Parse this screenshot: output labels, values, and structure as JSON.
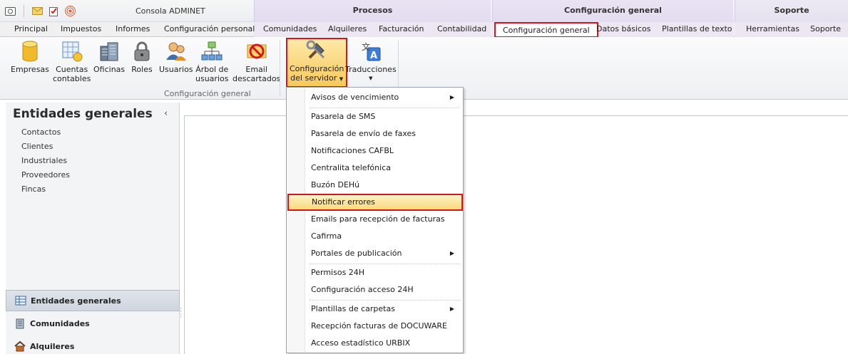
{
  "window": {
    "title": "Consola ADMINET"
  },
  "context_groups": [
    {
      "label": "Procesos"
    },
    {
      "label": "Configuración general"
    },
    {
      "label": "Soporte"
    }
  ],
  "tabs": [
    {
      "label": "Principal"
    },
    {
      "label": "Impuestos"
    },
    {
      "label": "Informes"
    },
    {
      "label": "Configuración personal"
    },
    {
      "label": "Comunidades"
    },
    {
      "label": "Alquileres"
    },
    {
      "label": "Facturación"
    },
    {
      "label": "Contabilidad"
    },
    {
      "label": "Configuración general",
      "active": true
    },
    {
      "label": "Datos básicos"
    },
    {
      "label": "Plantillas de texto"
    },
    {
      "label": "Herramientas"
    },
    {
      "label": "Soporte"
    }
  ],
  "ribbon": {
    "group_label": "Configuración general",
    "buttons": [
      {
        "line1": "Empresas",
        "line2": "",
        "icon": "database-icon"
      },
      {
        "line1": "Cuentas",
        "line2": "contables",
        "icon": "spreadsheet-icon"
      },
      {
        "line1": "Oficinas",
        "line2": "",
        "icon": "buildings-icon"
      },
      {
        "line1": "Roles",
        "line2": "",
        "icon": "padlock-icon"
      },
      {
        "line1": "Usuarios",
        "line2": "",
        "icon": "users-icon"
      },
      {
        "line1": "Árbol de",
        "line2": "usuarios",
        "icon": "org-tree-icon"
      },
      {
        "line1": "Email",
        "line2": "descartados",
        "icon": "blocked-email-icon"
      },
      {
        "line1": "Configuración",
        "line2": "del servidor",
        "icon": "tools-icon",
        "dropdown": true,
        "highlighted": true
      },
      {
        "line1": "Traducciones",
        "line2": "",
        "icon": "translate-icon",
        "dropdown": true
      }
    ]
  },
  "left_pane": {
    "title": "Entidades generales",
    "items": [
      "Contactos",
      "Clientes",
      "Industriales",
      "Proveedores",
      "Fincas"
    ],
    "nav": [
      {
        "label": "Entidades generales",
        "selected": true
      },
      {
        "label": "Comunidades"
      },
      {
        "label": "Alquileres"
      }
    ]
  },
  "menu": {
    "items": [
      {
        "label": "Avisos de vencimiento",
        "submenu": true
      },
      {
        "label": "Pasarela de SMS"
      },
      {
        "label": "Pasarela de envío de faxes"
      },
      {
        "label": "Notificaciones CAFBL"
      },
      {
        "label": "Centralita telefónica"
      },
      {
        "label": "Buzón DEHú"
      },
      {
        "label": "Notificar errores",
        "highlighted": true
      },
      {
        "label": "Emails para recepción de facturas"
      },
      {
        "label": "Cafirma"
      },
      {
        "label": "Portales de publicación",
        "submenu": true
      },
      {
        "label": "Permisos 24H"
      },
      {
        "label": "Configuración acceso 24H"
      },
      {
        "label": "Plantillas de carpetas",
        "submenu": true
      },
      {
        "label": "Recepción facturas de DOCUWARE"
      },
      {
        "label": "Acceso estadístico URBIX"
      }
    ]
  },
  "colors": {
    "highlight_border": "#d9151b",
    "highlight_fill": "#f9d97a",
    "context_purple": "#e4dcf0"
  }
}
